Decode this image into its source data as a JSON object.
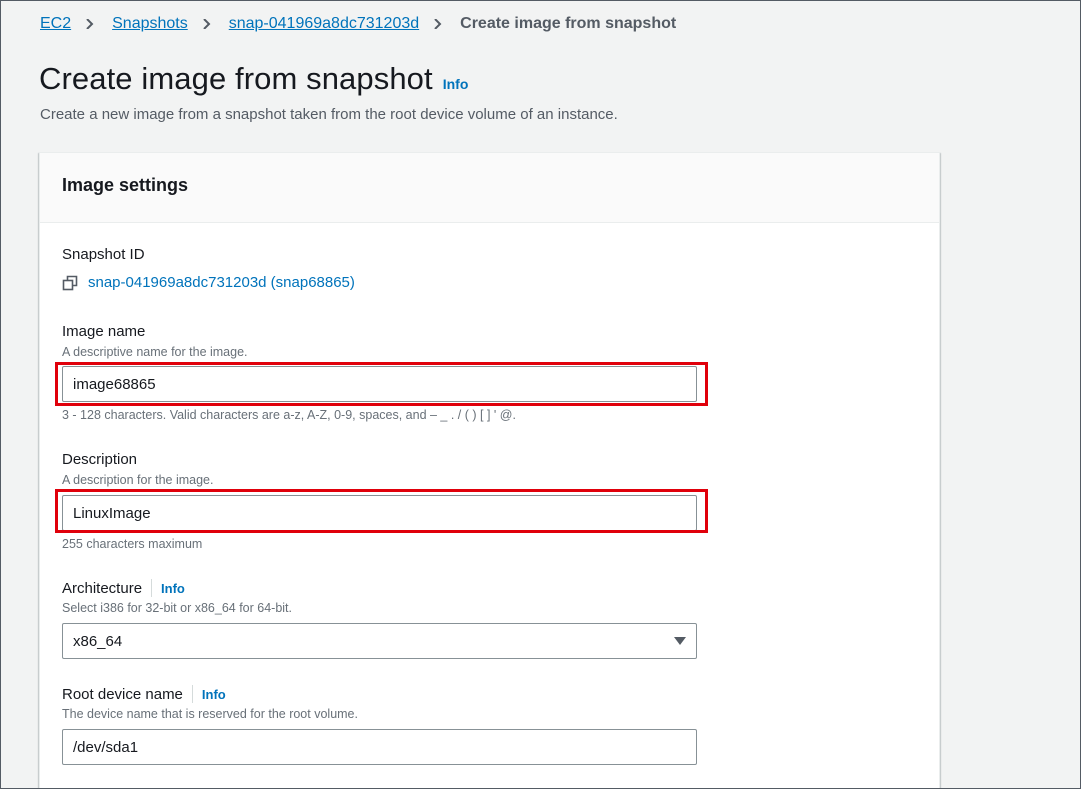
{
  "breadcrumb": {
    "items": [
      "EC2",
      "Snapshots",
      "snap-041969a8dc731203d"
    ],
    "current": "Create image from snapshot"
  },
  "page": {
    "title": "Create image from snapshot",
    "info_label": "Info",
    "description": "Create a new image from a snapshot taken from the root device volume of an instance."
  },
  "panel": {
    "title": "Image settings",
    "snapshot": {
      "label": "Snapshot ID",
      "value": "snap-041969a8dc731203d (snap68865)"
    },
    "image_name": {
      "label": "Image name",
      "hint": "A descriptive name for the image.",
      "value": "image68865",
      "constraint": "3 - 128 characters. Valid characters are a-z, A-Z, 0-9, spaces, and – _ . / ( ) [ ] ' @."
    },
    "description": {
      "label": "Description",
      "hint": "A description for the image.",
      "value": "LinuxImage",
      "constraint": "255 characters maximum"
    },
    "architecture": {
      "label": "Architecture",
      "info_label": "Info",
      "hint": "Select i386 for 32-bit or x86_64 for 64-bit.",
      "selected": "x86_64"
    },
    "root_device": {
      "label": "Root device name",
      "info_label": "Info",
      "hint": "The device name that is reserved for the root volume.",
      "value": "/dev/sda1"
    }
  },
  "colors": {
    "link": "#0073bb",
    "highlight": "#e0000b",
    "background": "#f2f3f3"
  },
  "icons": [
    "chevron-right-icon",
    "copy-icon",
    "caret-down-icon"
  ]
}
